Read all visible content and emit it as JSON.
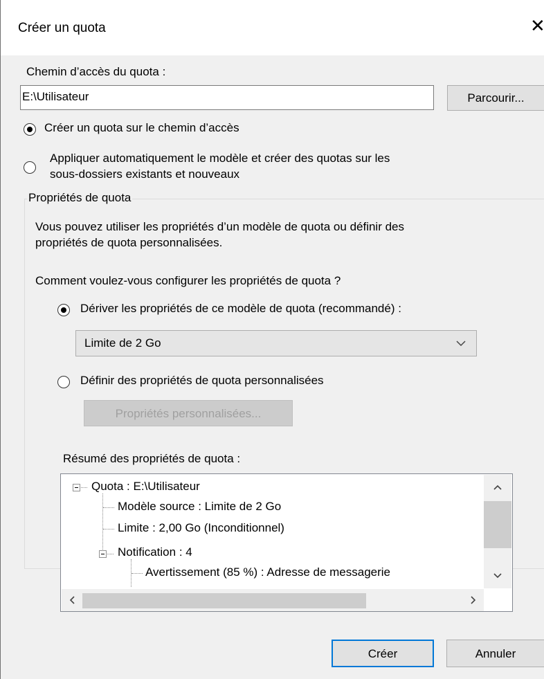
{
  "dialog": {
    "title": "Créer un quota",
    "close": "✕"
  },
  "path": {
    "label": "Chemin d’accès du quota :",
    "value": "E:\\Utilisateur",
    "browse": "Parcourir..."
  },
  "options": {
    "create_on_path": "Créer un quota sur le chemin d’accès",
    "auto_apply_line1": "Appliquer automatiquement le modèle et créer des quotas sur les",
    "auto_apply_line2": "sous-dossiers existants et nouveaux",
    "selected": "create_on_path"
  },
  "properties": {
    "group_title": "Propriétés de quota",
    "desc_line1": "Vous pouvez utiliser les propriétés d’un modèle de quota ou définir des",
    "desc_line2": "propriétés de quota personnalisées.",
    "question": "Comment voulez-vous configurer les propriétés de quota ?",
    "derive_label": "Dériver les propriétés de ce modèle de quota (recommandé) :",
    "template_value": "Limite de 2 Go",
    "custom_label": "Définir des propriétés de quota personnalisées",
    "custom_button": "Propriétés personnalisées...",
    "selected": "derive"
  },
  "summary": {
    "label": "Résumé des propriétés de quota :",
    "tree": {
      "root": "Quota : E:\\Utilisateur",
      "source": "Modèle source : Limite de 2 Go",
      "limit": "Limite : 2,00 Go (Inconditionnel)",
      "notification": "Notification : 4",
      "warning": "Avertissement (85 %) : Adresse de messagerie"
    }
  },
  "footer": {
    "create": "Créer",
    "cancel": "Annuler"
  },
  "icons": {
    "scroll_up": "chevron-up-icon",
    "scroll_down": "chevron-down-icon",
    "scroll_left": "chevron-left-icon",
    "scroll_right": "chevron-right-icon"
  },
  "colors": {
    "accent": "#0078d7",
    "dialog_bg": "#f0f0f0",
    "titlebar_bg": "#ffffff"
  }
}
